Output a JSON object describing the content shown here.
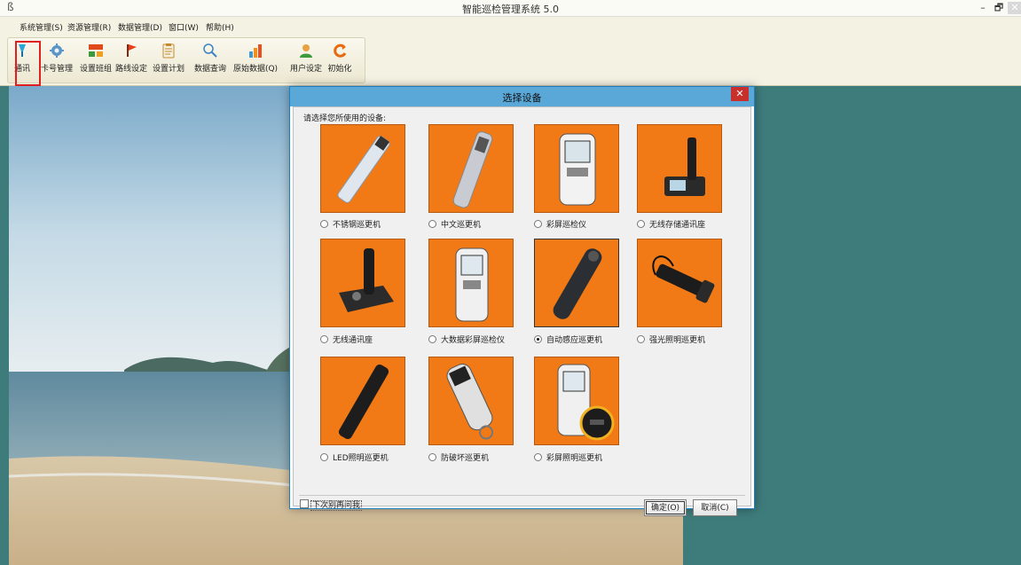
{
  "window": {
    "title": "智能巡检管理系统 5.0",
    "app_icon": "ß",
    "minimize_glyph": "–",
    "restore_glyph": "🗗",
    "close_glyph": "✕"
  },
  "menu": [
    "系统管理(S)",
    "资源管理(R)",
    "数据管理(D)",
    "窗口(W)",
    "帮助(H)"
  ],
  "toolbar": {
    "buttons": [
      {
        "label": "通讯",
        "icon": "communication-icon"
      },
      {
        "label": "卡号管理",
        "icon": "card-management-icon"
      },
      {
        "label": "设置班组",
        "icon": "team-setup-icon"
      },
      {
        "label": "路线设定",
        "icon": "route-flag-icon"
      },
      {
        "label": "设置计划",
        "icon": "plan-clipboard-icon"
      },
      {
        "label": "数据查询",
        "icon": "search-icon"
      },
      {
        "label": "原始数据(Q)",
        "icon": "bar-chart-icon"
      },
      {
        "label": "用户设定",
        "icon": "user-icon"
      },
      {
        "label": "初始化",
        "icon": "refresh-icon"
      }
    ],
    "selected_index": 0,
    "highlight_color": "#e02020"
  },
  "dialog": {
    "title": "选择设备",
    "close_glyph": "✕",
    "prompt": "请选择您所使用的设备:",
    "devices": [
      {
        "label": "不锈钢巡更机",
        "selected": false
      },
      {
        "label": "中文巡更机",
        "selected": false
      },
      {
        "label": "彩屏巡检仪",
        "selected": false
      },
      {
        "label": "无线存储通讯座",
        "selected": false
      },
      {
        "label": "无线通讯座",
        "selected": false
      },
      {
        "label": "大数据彩屏巡检仪",
        "selected": false
      },
      {
        "label": "自动感应巡更机",
        "selected": true
      },
      {
        "label": "强光照明巡更机",
        "selected": false
      },
      {
        "label": "LED照明巡更机",
        "selected": false
      },
      {
        "label": "防破坏巡更机",
        "selected": false
      },
      {
        "label": "彩屏照明巡更机",
        "selected": false
      }
    ],
    "checkbox_label": "下次别再问我",
    "checkbox_checked": false,
    "ok_label": "确定(O)",
    "cancel_label": "取消(C)",
    "colors": {
      "card_orange": "#f17a16",
      "header_blue": "#5aa8d8",
      "close_red": "#c9302c"
    }
  },
  "background": {
    "desktop_color": "#3e7b7b",
    "scene": "seaside-beach-photo"
  }
}
